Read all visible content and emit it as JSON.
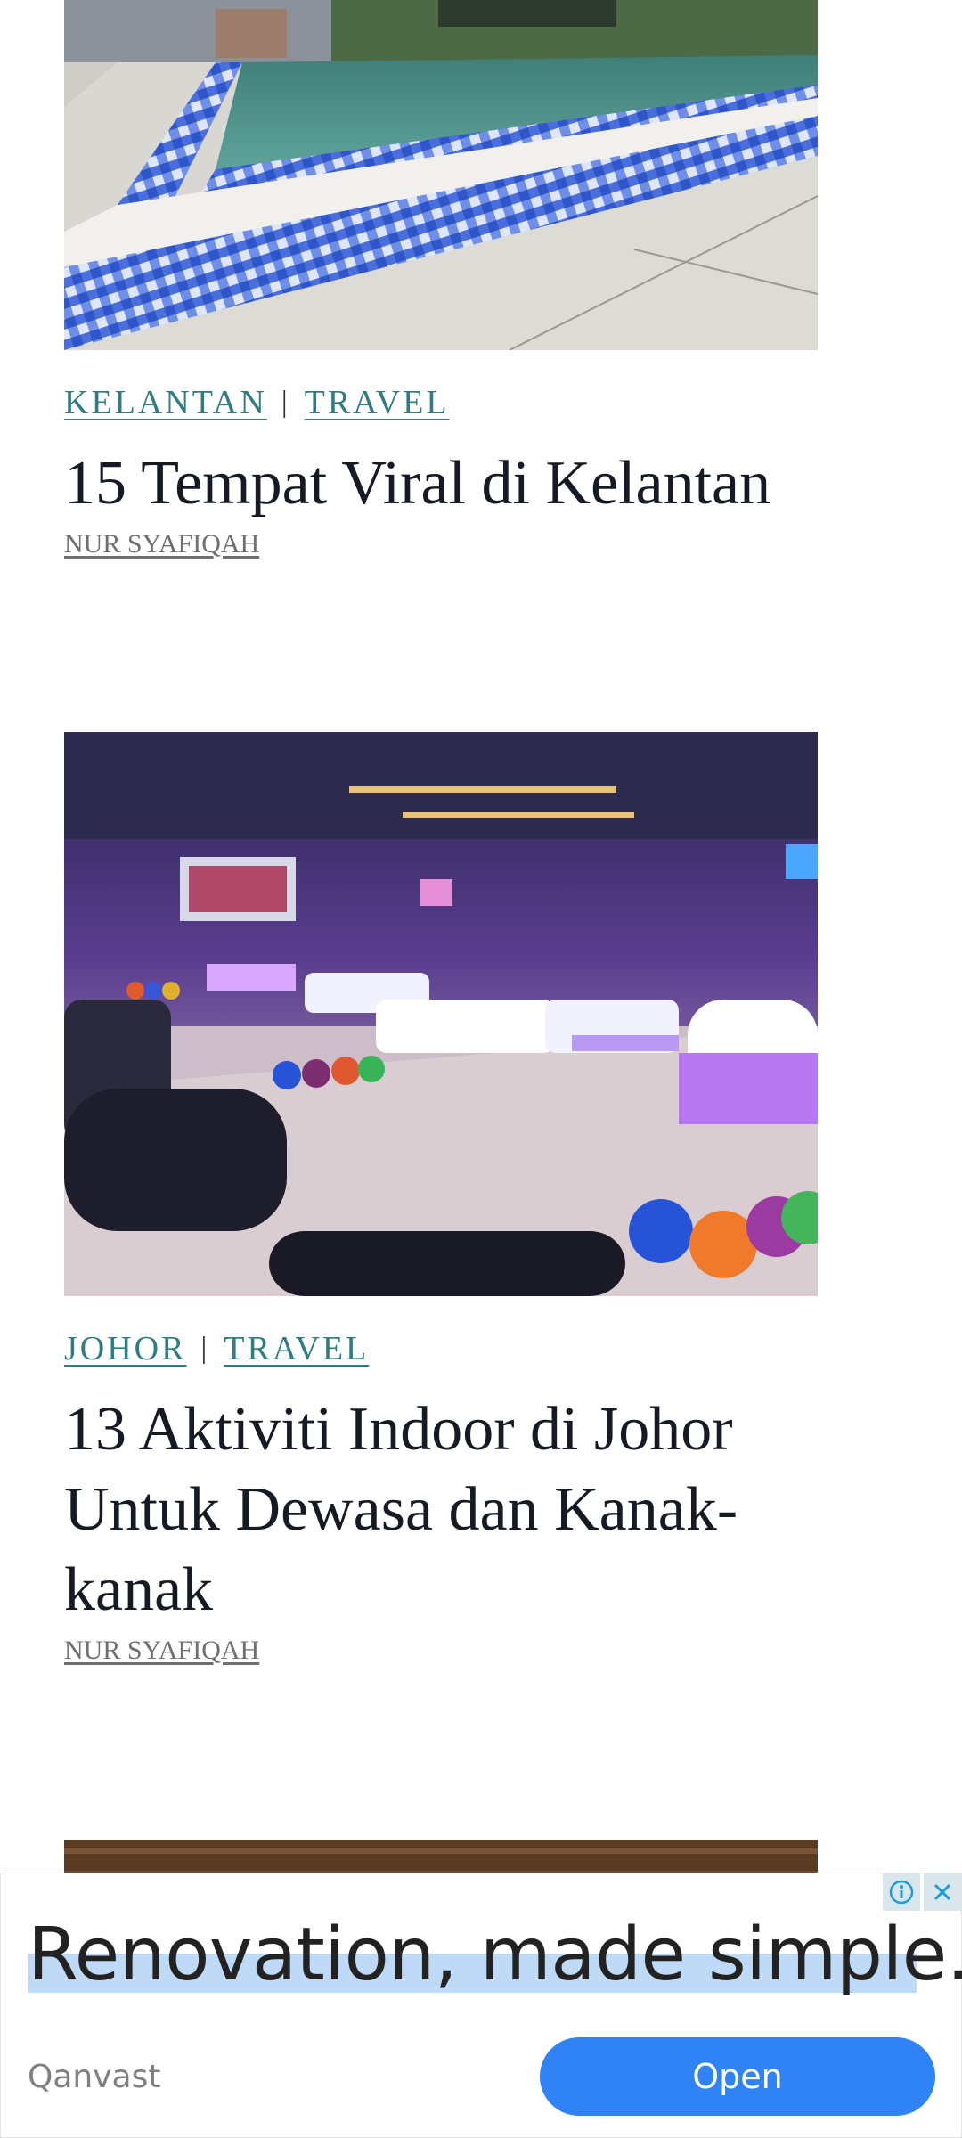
{
  "articles": [
    {
      "categories": [
        "KELANTAN",
        "TRAVEL"
      ],
      "separator": "|",
      "title": "15 Tempat Viral di Kelantan",
      "author": "NUR SYAFIQAH"
    },
    {
      "categories": [
        "JOHOR",
        "TRAVEL"
      ],
      "separator": "|",
      "title": "13 Aktiviti Indoor di Johor Untuk Dewasa dan Kanak-kanak",
      "author": "NUR SYAFIQAH"
    }
  ],
  "ad": {
    "headline": "Renovation, made simple.",
    "brand": "Qanvast",
    "cta": "Open",
    "info_icon": "info-icon",
    "close_icon": "close-icon"
  },
  "colors": {
    "category_link": "#2f7d82",
    "title_text": "#151a24",
    "ad_button": "#2f83f5",
    "ad_highlight": "#bfdaf6"
  }
}
